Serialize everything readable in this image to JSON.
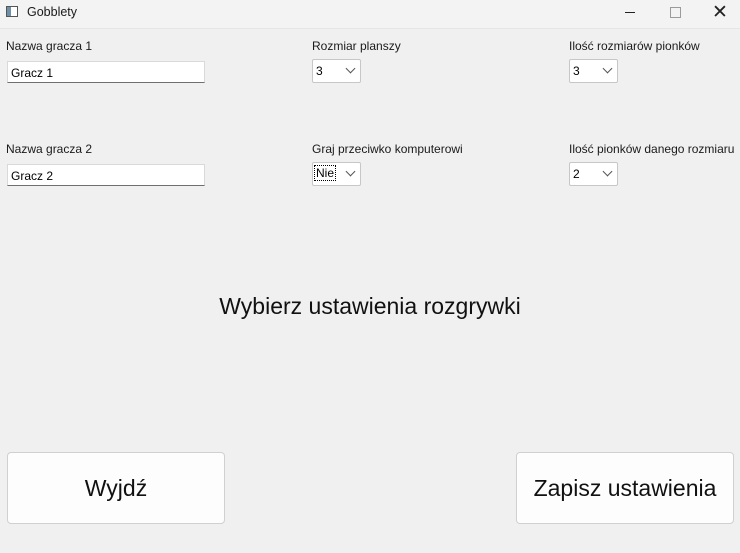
{
  "window": {
    "title": "Gobblety",
    "minimize": "",
    "maximize": "",
    "close": "✕"
  },
  "player1": {
    "label": "Nazwa gracza 1",
    "value": "Gracz 1"
  },
  "player2": {
    "label": "Nazwa gracza 2",
    "value": "Gracz 2"
  },
  "board_size": {
    "label": "Rozmiar planszy",
    "value": "3"
  },
  "vs_computer": {
    "label": "Graj przeciwko komputerowi",
    "value": "Nie"
  },
  "piece_sizes": {
    "label": "Ilość rozmiarów pionków",
    "value": "3"
  },
  "pieces_per_size": {
    "label": "Ilość pionków danego rozmiaru",
    "value": "2"
  },
  "headline": "Wybierz ustawienia rozgrywki",
  "buttons": {
    "exit": "Wyjdź",
    "save": "Zapisz ustawienia"
  }
}
